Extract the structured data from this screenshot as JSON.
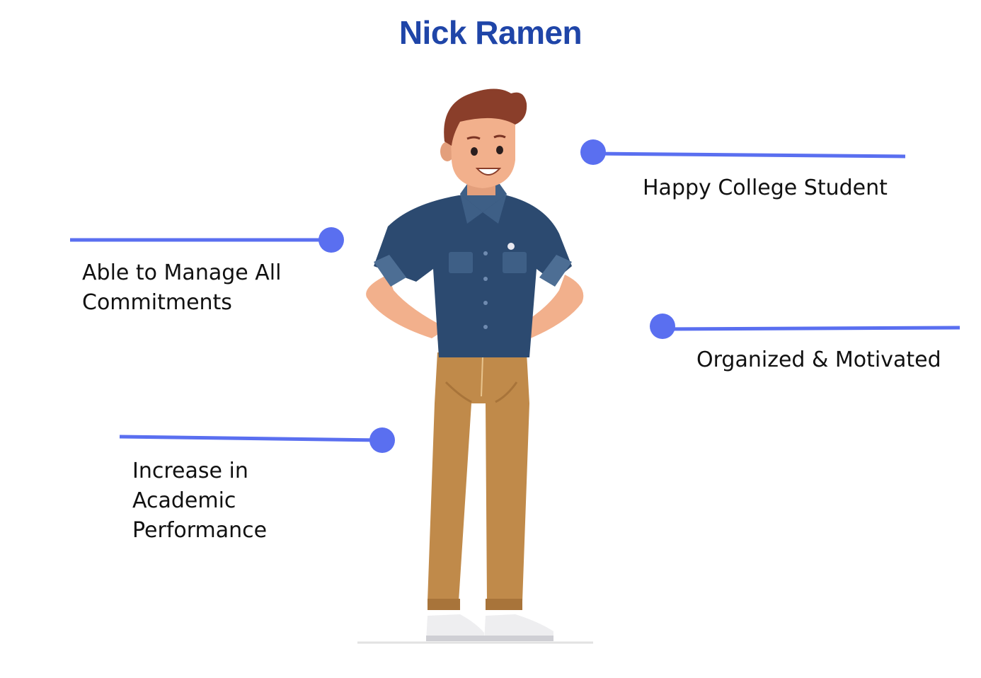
{
  "title": "Nick Ramen",
  "colors": {
    "title": "#1f45a8",
    "connector": "#5a6ff0",
    "text": "#111111",
    "shirt": "#2c4a70",
    "pants": "#c08a4a",
    "skin": "#f2b08c",
    "hair": "#8a3e2a"
  },
  "traits": {
    "happy": {
      "lines": [
        "Happy College Student"
      ]
    },
    "manage": {
      "lines": [
        "Able to Manage All",
        "Commitments"
      ]
    },
    "organized": {
      "lines": [
        "Organized & Motivated"
      ]
    },
    "increase": {
      "lines": [
        "Increase in",
        "Academic",
        "Performance"
      ]
    }
  },
  "figure": {
    "icon": "student-character-illustration"
  }
}
